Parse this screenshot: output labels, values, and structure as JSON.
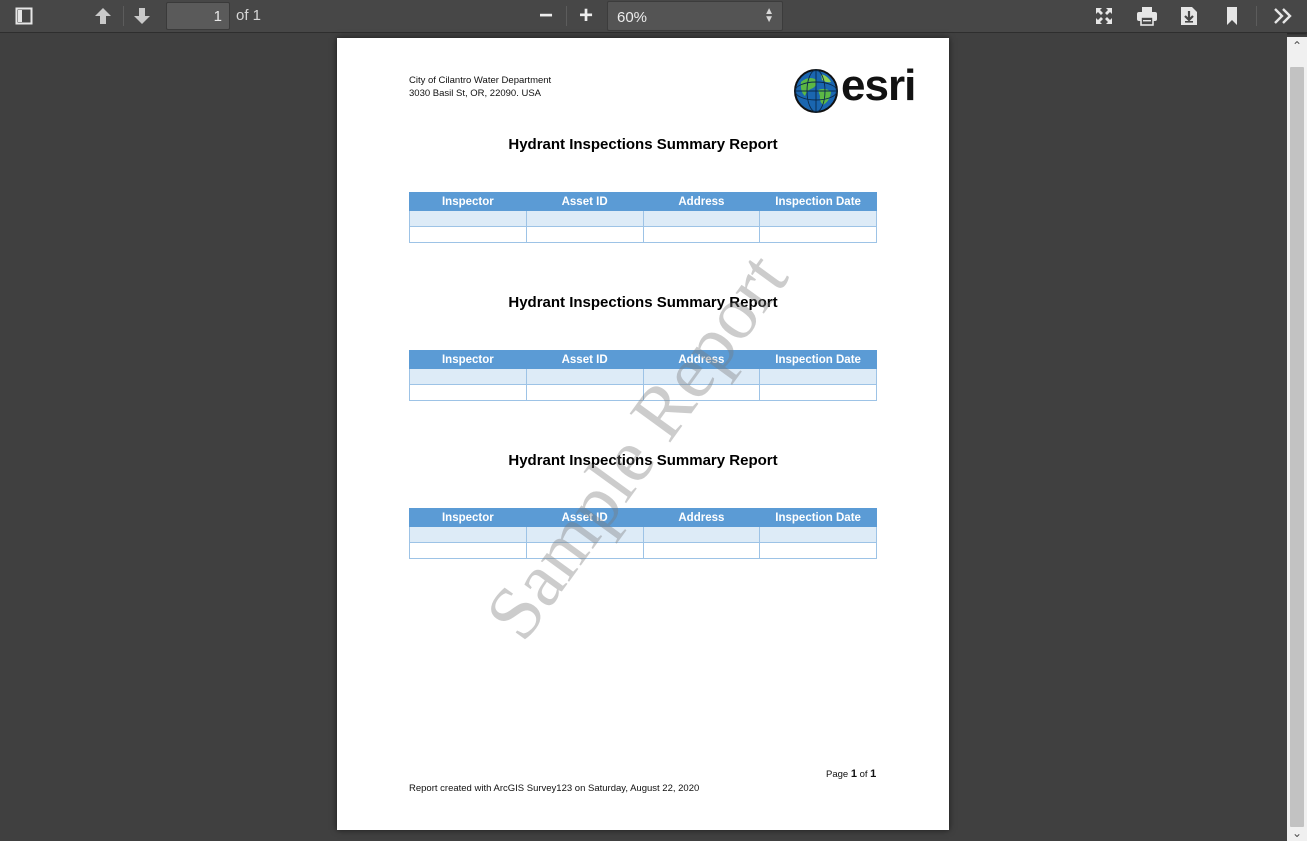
{
  "toolbar": {
    "page_number": "1",
    "page_count_text": "of 1",
    "zoom_value": "60%",
    "zoom_out_label": "−",
    "zoom_in_label": "+"
  },
  "document": {
    "org_name": "City of Cilantro Water Department",
    "org_address": "3030 Basil St, OR, 22090. USA",
    "logo_text": "esri",
    "watermark": "Sample Report",
    "sections": [
      {
        "title": "Hydrant Inspections Summary Report",
        "columns": [
          "Inspector",
          "Asset ID",
          "Address",
          "Inspection Date"
        ]
      },
      {
        "title": "Hydrant Inspections Summary Report",
        "columns": [
          "Inspector",
          "Asset ID",
          "Address",
          "Inspection Date"
        ]
      },
      {
        "title": "Hydrant Inspections Summary Report",
        "columns": [
          "Inspector",
          "Asset ID",
          "Address",
          "Inspection Date"
        ]
      }
    ],
    "footer": {
      "page_word": "Page",
      "page_current": "1",
      "page_of_word": "of",
      "page_total": "1",
      "created_text": "Report created with ArcGIS Survey123 on Saturday, August 22, 2020"
    }
  },
  "colors": {
    "header_blue": "#5b9bd5",
    "row_tint": "#ddebf7",
    "viewer_bg": "#404040"
  },
  "icons": {
    "sidebar_toggle": "sidebar-toggle-icon",
    "previous_page": "arrow-up-icon",
    "next_page": "arrow-down-icon",
    "presentation_mode": "fullscreen-icon",
    "print": "printer-icon",
    "download": "download-icon",
    "bookmark": "bookmark-icon",
    "tools": "double-chevron-right-icon"
  }
}
